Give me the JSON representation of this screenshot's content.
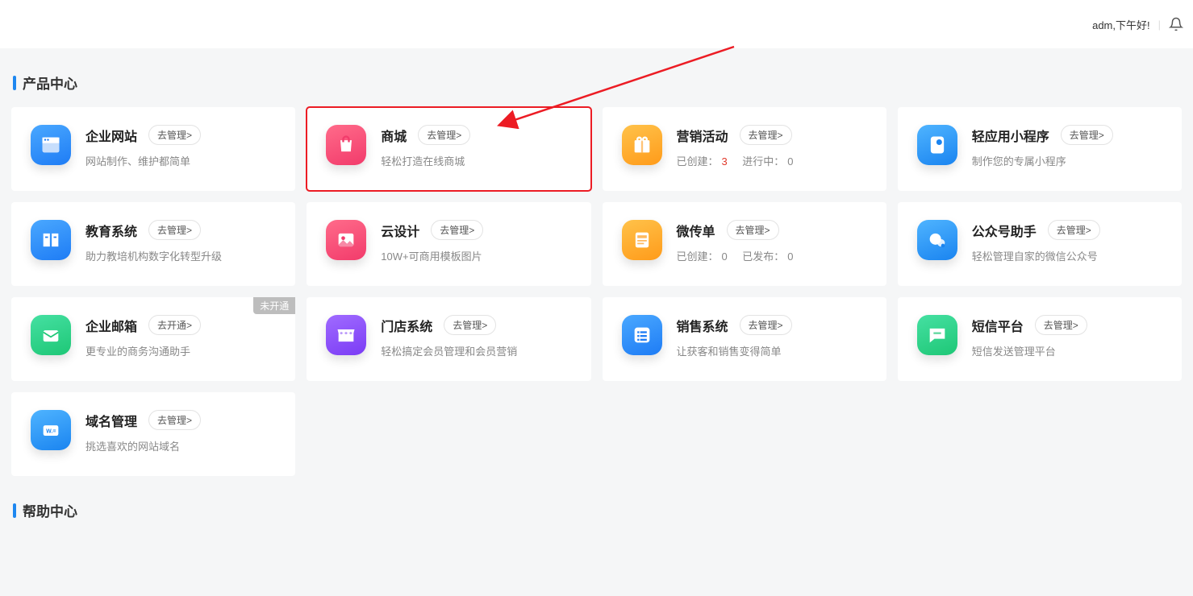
{
  "header": {
    "greeting": "adm,下午好!"
  },
  "sections": {
    "products_title": "产品中心",
    "help_title": "帮助中心"
  },
  "cards": [
    {
      "title": "企业网站",
      "action": "去管理>",
      "desc": "网站制作、维护都简单",
      "icon": "website-icon",
      "bg": "bg-blue"
    },
    {
      "title": "商城",
      "action": "去管理>",
      "desc": "轻松打造在线商城",
      "icon": "shop-icon",
      "bg": "bg-pink",
      "highlighted": true
    },
    {
      "title": "营销活动",
      "action": "去管理>",
      "stats_prefix1": "已创建：",
      "stats_val1": "3",
      "stats_prefix2": "进行中：",
      "stats_val2": "0",
      "icon": "gift-icon",
      "bg": "bg-orange"
    },
    {
      "title": "轻应用小程序",
      "action": "去管理>",
      "desc": "制作您的专属小程序",
      "icon": "miniapp-icon",
      "bg": "bg-blue2"
    },
    {
      "title": "教育系统",
      "action": "去管理>",
      "desc": "助力教培机构数字化转型升级",
      "icon": "book-icon",
      "bg": "bg-blue"
    },
    {
      "title": "云设计",
      "action": "去管理>",
      "desc": "10W+可商用模板图片",
      "icon": "image-icon",
      "bg": "bg-pink"
    },
    {
      "title": "微传单",
      "action": "去管理>",
      "stats_prefix1": "已创建：",
      "stats_val1": "0",
      "stats_prefix2": "已发布：",
      "stats_val2": "0",
      "icon": "flyer-icon",
      "bg": "bg-orange"
    },
    {
      "title": "公众号助手",
      "action": "去管理>",
      "desc": "轻松管理自家的微信公众号",
      "icon": "wechat-icon",
      "bg": "bg-blue2"
    },
    {
      "title": "企业邮箱",
      "action": "去开通>",
      "desc": "更专业的商务沟通助手",
      "icon": "mail-icon",
      "bg": "bg-green",
      "badge": "未开通"
    },
    {
      "title": "门店系统",
      "action": "去管理>",
      "desc": "轻松搞定会员管理和会员营销",
      "icon": "store-icon",
      "bg": "bg-purple"
    },
    {
      "title": "销售系统",
      "action": "去管理>",
      "desc": "让获客和销售变得简单",
      "icon": "list-icon",
      "bg": "bg-blue"
    },
    {
      "title": "短信平台",
      "action": "去管理>",
      "desc": "短信发送管理平台",
      "icon": "sms-icon",
      "bg": "bg-green"
    },
    {
      "title": "域名管理",
      "action": "去管理>",
      "desc": "挑选喜欢的网站域名",
      "icon": "domain-icon",
      "bg": "bg-blue2"
    }
  ]
}
